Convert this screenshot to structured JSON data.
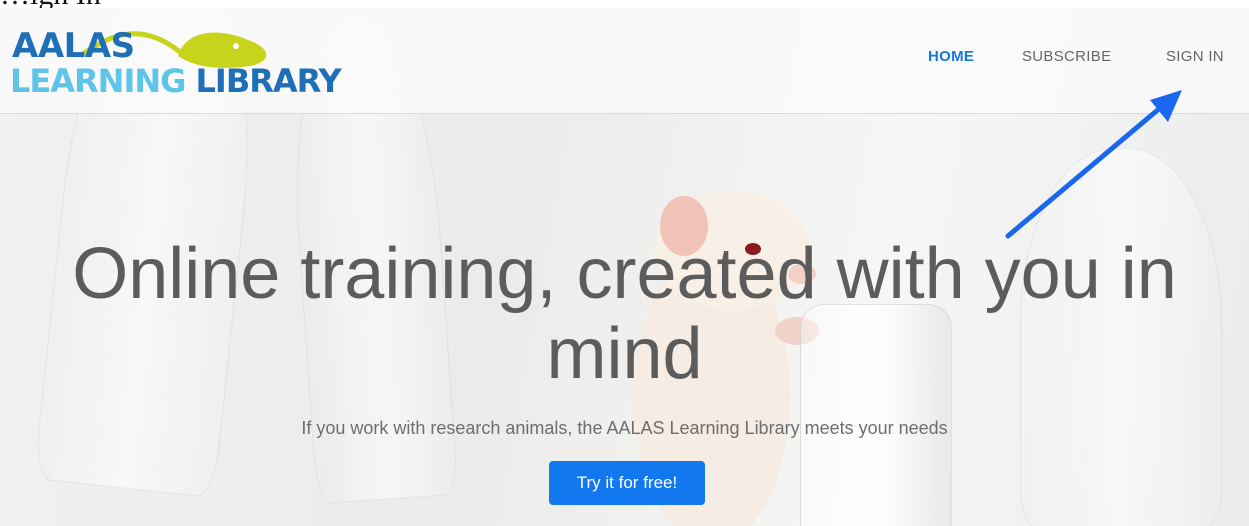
{
  "caption": "…ign In",
  "logo": {
    "line1": "AALAS",
    "line2a": "LEARNING",
    "line2b": " LIBRARY"
  },
  "nav": {
    "home": "HOME",
    "subscribe": "SUBSCRIBE",
    "sign_in": "SIGN IN"
  },
  "hero": {
    "headline": "Online training, created with you in mind",
    "subheadline": "If you work with research animals, the AALAS Learning Library meets your needs",
    "cta": "Try it for free!"
  },
  "colors": {
    "accent": "#1178e6",
    "logo_blue": "#1f6fb6",
    "logo_light": "#5ec4e8",
    "logo_green": "#c8d41c"
  }
}
